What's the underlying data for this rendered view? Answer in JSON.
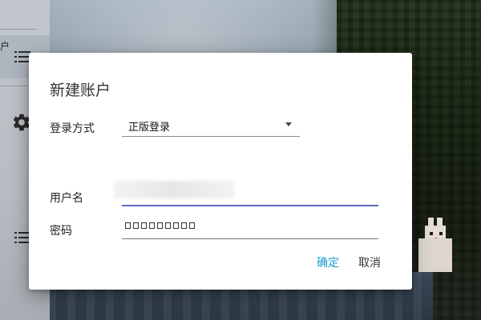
{
  "window": {
    "accent": "#3e4a8a"
  },
  "sidebar": {
    "partial_label": "户",
    "items": [
      {
        "icon": "list-icon"
      },
      {
        "icon": "gear-icon"
      },
      {
        "icon": "list-icon"
      }
    ]
  },
  "dialog": {
    "title": "新建账户",
    "login_method_label": "登录方式",
    "login_method_value": "正版登录",
    "username_label": "用户名",
    "password_label": "密码",
    "password_mask_count": 9,
    "confirm_label": "确定",
    "cancel_label": "取消",
    "colors": {
      "confirm": "#1a9bd1",
      "input_focus": "#5c6bc0"
    }
  }
}
